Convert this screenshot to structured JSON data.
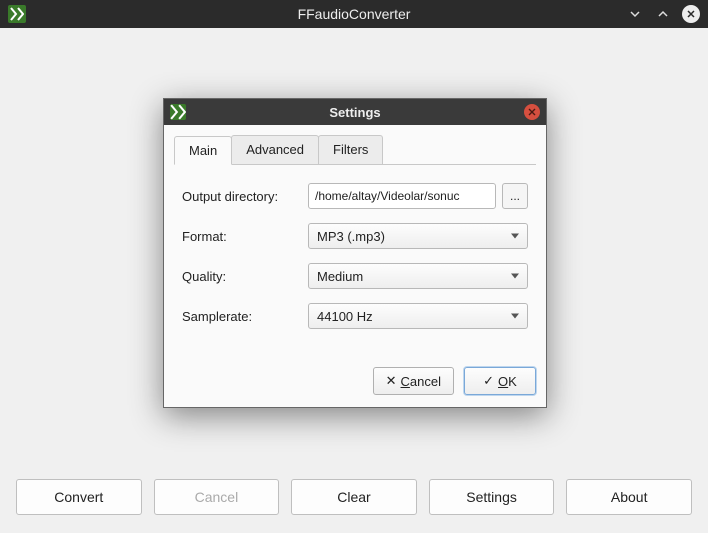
{
  "app": {
    "title": "FFaudioConverter",
    "icon": "ffmpeg-icon"
  },
  "footer": {
    "convert": "Convert",
    "cancel": "Cancel",
    "clear": "Clear",
    "settings": "Settings",
    "about": "About"
  },
  "modal": {
    "title": "Settings",
    "tabs": {
      "main": "Main",
      "advanced": "Advanced",
      "filters": "Filters"
    },
    "labels": {
      "output_directory": "Output directory:",
      "format": "Format:",
      "quality": "Quality:",
      "samplerate": "Samplerate:"
    },
    "values": {
      "output_directory": "/home/altay/Videolar/sonuc",
      "format": "MP3 (.mp3)",
      "quality": "Medium",
      "samplerate": "44100 Hz",
      "browse": "..."
    },
    "actions": {
      "cancel_prefix": "✕ ",
      "cancel_u": "C",
      "cancel_rest": "ancel",
      "ok_prefix": "✓ ",
      "ok_u": "O",
      "ok_rest": "K"
    }
  }
}
